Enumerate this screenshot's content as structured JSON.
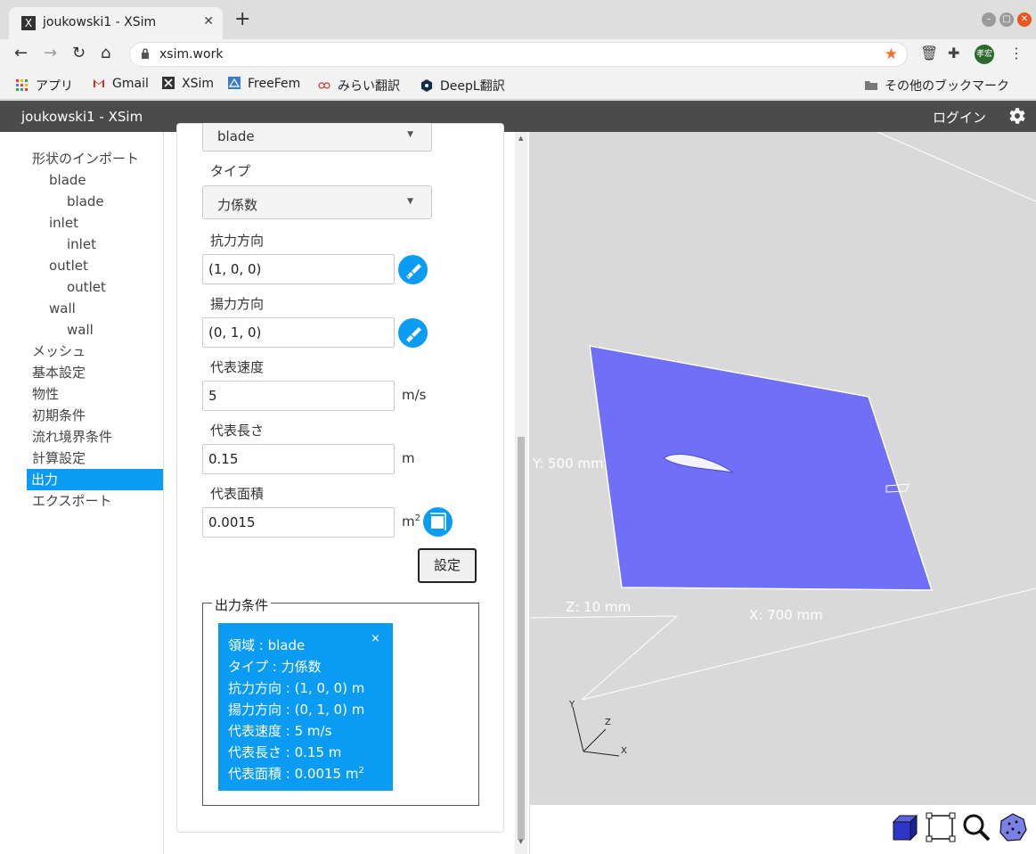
{
  "browser": {
    "tab_title": "joukowski1 - XSim",
    "tab_favicon": "X",
    "url": "xsim.work",
    "avatar_text": "孝宏",
    "bookmarks": [
      {
        "label": "アプリ",
        "icon": "apps-grid-icon"
      },
      {
        "label": "Gmail",
        "icon": "gmail-icon"
      },
      {
        "label": "XSim",
        "icon": "xsim-icon"
      },
      {
        "label": "FreeFem",
        "icon": "freefem-icon"
      },
      {
        "label": "みらい翻訳",
        "icon": "mirai-icon"
      },
      {
        "label": "DeepL翻訳",
        "icon": "deepl-icon"
      }
    ],
    "other_bookmarks": "その他のブックマーク"
  },
  "app": {
    "title": "joukowski1 - XSim",
    "login": "ログイン"
  },
  "sidebar": {
    "items": [
      {
        "label": "形状のインポート",
        "indent": 0
      },
      {
        "label": "blade",
        "indent": 1
      },
      {
        "label": "blade",
        "indent": 2
      },
      {
        "label": "inlet",
        "indent": 1
      },
      {
        "label": "inlet",
        "indent": 2
      },
      {
        "label": "outlet",
        "indent": 1
      },
      {
        "label": "outlet",
        "indent": 2
      },
      {
        "label": "wall",
        "indent": 1
      },
      {
        "label": "wall",
        "indent": 2
      },
      {
        "label": "メッシュ",
        "indent": 0
      },
      {
        "label": "基本設定",
        "indent": 0
      },
      {
        "label": "物性",
        "indent": 0
      },
      {
        "label": "初期条件",
        "indent": 0
      },
      {
        "label": "流れ境界条件",
        "indent": 0
      },
      {
        "label": "計算設定",
        "indent": 0
      },
      {
        "label": "出力",
        "indent": 0,
        "active": true
      },
      {
        "label": "エクスポート",
        "indent": 0
      }
    ]
  },
  "form": {
    "region_select": "blade",
    "type_label": "タイプ",
    "type_select": "力係数",
    "drag_label": "抗力方向",
    "drag_value": "(1, 0, 0)",
    "lift_label": "揚力方向",
    "lift_value": "(0, 1, 0)",
    "speed_label": "代表速度",
    "speed_value": "5",
    "speed_unit": "m/s",
    "length_label": "代表長さ",
    "length_value": "0.15",
    "length_unit": "m",
    "area_label": "代表面積",
    "area_value": "0.0015",
    "area_unit": "m",
    "area_unit_sup": "2",
    "set_button": "設定"
  },
  "output_conditions": {
    "legend": "出力条件",
    "close": "×",
    "lines": [
      "領域 : blade",
      "タイプ : 力係数",
      "抗力方向 : (1, 0, 0) m",
      "揚力方向 : (0, 1, 0) m",
      "代表速度 : 5 m/s",
      "代表長さ : 0.15 m"
    ],
    "last_line": "代表面積 : 0.0015 m",
    "last_line_sup": "2"
  },
  "viewport": {
    "label_y": "Y: 500 mm",
    "label_z": "Z: 10 mm",
    "label_x": "X: 700 mm",
    "axis_y": "Y",
    "axis_z": "Z",
    "axis_x": "X",
    "plate_color": "#6f6ff8",
    "background": "#d9d9d9",
    "tools": [
      "solid-view-icon",
      "fit-view-icon",
      "zoom-icon",
      "point-view-icon"
    ]
  },
  "colors": {
    "accent": "#0a9cf5",
    "appbar": "#4b4b4b"
  }
}
